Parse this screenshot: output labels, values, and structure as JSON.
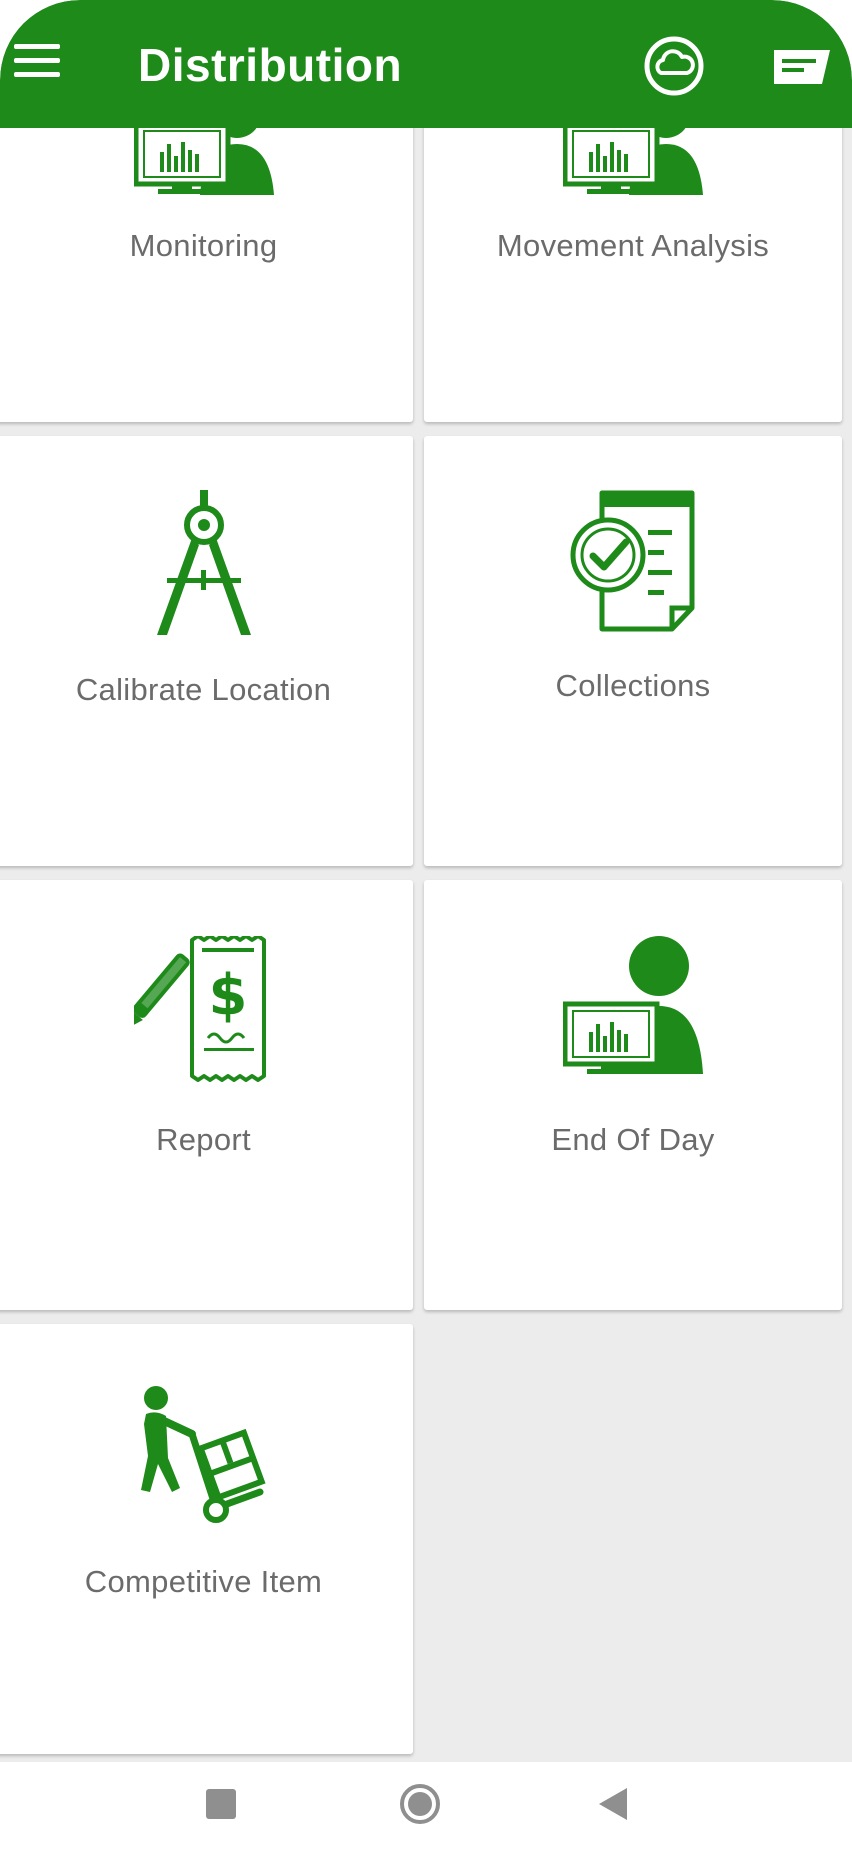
{
  "app": {
    "title": "Distribution",
    "accent_color": "#1e8a1a",
    "background": "#ececec"
  },
  "header": {
    "menu_icon": "hamburger-menu-icon",
    "sync_icon": "cloud-sync-icon",
    "message_icon": "message-icon"
  },
  "tiles": [
    {
      "label": "Monitoring",
      "icon": "monitor-user-icon"
    },
    {
      "label": "Movement Analysis",
      "icon": "monitor-user-icon"
    },
    {
      "label": "Calibrate Location",
      "icon": "compass-drafting-icon"
    },
    {
      "label": "Collections",
      "icon": "checklist-document-icon"
    },
    {
      "label": "Report",
      "icon": "receipt-pen-icon"
    },
    {
      "label": "End Of Day",
      "icon": "monitor-user-icon"
    },
    {
      "label": "Competitive Item",
      "icon": "hand-truck-icon"
    }
  ],
  "system_nav": {
    "recents": "recents-square-icon",
    "home": "home-circle-icon",
    "back": "back-triangle-icon"
  }
}
